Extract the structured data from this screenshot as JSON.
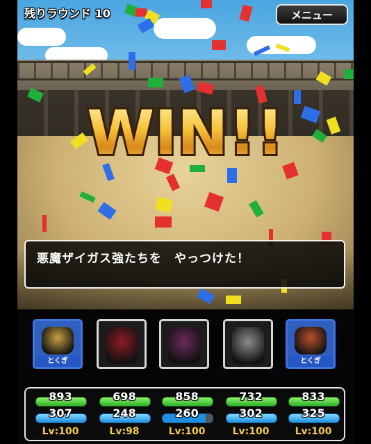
{
  "header": {
    "rounds_left": "残りラウンド 10",
    "menu_label": "メニュー"
  },
  "banner": {
    "text": "WIN!!"
  },
  "message": {
    "text": "悪魔ザイガス強たちを　やっつけた！"
  },
  "party": [
    {
      "name_icon": "golden-horned-knight-icon",
      "badge": "とくぎ",
      "kind": "ally",
      "hp": "893",
      "mp": "307",
      "mp_fill": 1.0,
      "level": "Lv:100"
    },
    {
      "name_icon": "dark-orb-demon-icon",
      "badge": "",
      "kind": "monster",
      "hp": "698",
      "mp": "248",
      "mp_fill": 1.0,
      "level": "Lv:98"
    },
    {
      "name_icon": "masked-sorcerer-icon",
      "badge": "",
      "kind": "monster",
      "hp": "858",
      "mp": "260",
      "mp_fill": 0.86,
      "level": "Lv:100"
    },
    {
      "name_icon": "skeletal-beast-icon",
      "badge": "",
      "kind": "monster",
      "hp": "732",
      "mp": "302",
      "mp_fill": 1.0,
      "level": "Lv:100"
    },
    {
      "name_icon": "green-haired-warrior-icon",
      "badge": "とくぎ",
      "kind": "ally",
      "hp": "833",
      "mp": "325",
      "mp_fill": 1.0,
      "level": "Lv:100"
    }
  ],
  "colors": {
    "hp_bar": "#2fb22a",
    "mp_bar": "#1f8fe0",
    "level_text": "#f2c94c",
    "ally_frame": "#3d74e0"
  }
}
